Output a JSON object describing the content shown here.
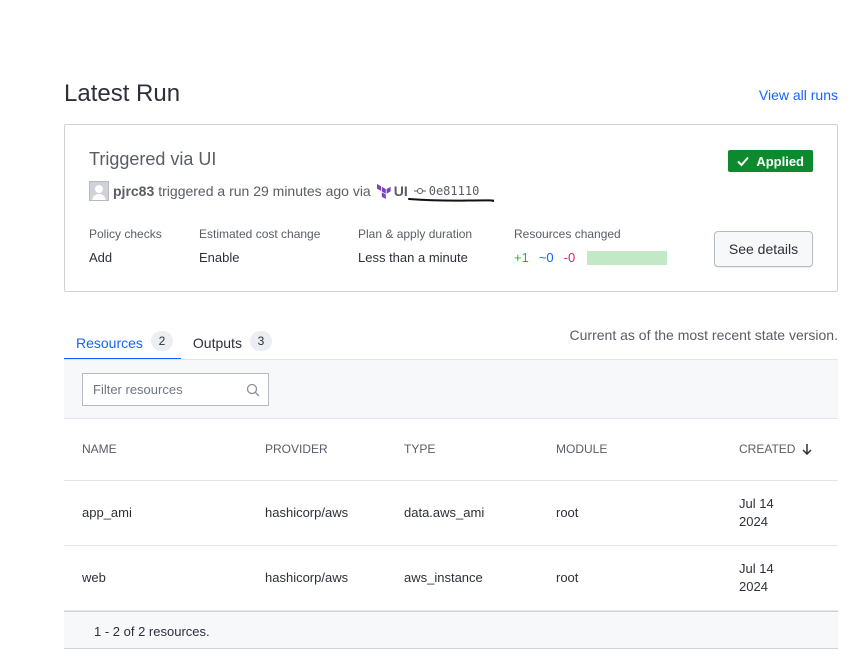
{
  "header": {
    "title": "Latest Run",
    "view_all_label": "View all runs"
  },
  "run": {
    "title": "Triggered via UI",
    "status": "Applied",
    "username": "pjrc83",
    "action_text": "triggered a run 29 minutes ago via",
    "source": "UI",
    "commit": "0e81110",
    "stats": {
      "policy_label": "Policy checks",
      "policy_value": "Add",
      "cost_label": "Estimated cost change",
      "cost_value": "Enable",
      "duration_label": "Plan & apply duration",
      "duration_value": "Less than a minute",
      "resources_label": "Resources changed",
      "added": "+1",
      "changed": "~0",
      "destroyed": "-0"
    },
    "details_button": "See details"
  },
  "tabs": [
    {
      "label": "Resources",
      "count": "2"
    },
    {
      "label": "Outputs",
      "count": "3"
    }
  ],
  "state_note": "Current as of the most recent state version.",
  "filter": {
    "placeholder": "Filter resources"
  },
  "table": {
    "headers": [
      "NAME",
      "PROVIDER",
      "TYPE",
      "MODULE",
      "CREATED"
    ],
    "rows": [
      {
        "name": "app_ami",
        "provider": "hashicorp/aws",
        "type": "data.aws_ami",
        "module": "root",
        "created_1": "Jul 14",
        "created_2": "2024"
      },
      {
        "name": "web",
        "provider": "hashicorp/aws",
        "type": "aws_instance",
        "module": "root",
        "created_1": "Jul 14",
        "created_2": "2024"
      }
    ],
    "footer": "1 - 2 of 2 resources."
  },
  "colors": {
    "accent": "#1563ff",
    "applied": "#0e8a2e",
    "terraform": "#7b42bc"
  },
  "icons": [
    "check-icon",
    "avatar",
    "terraform-icon",
    "commit-icon",
    "search-icon",
    "sort-down-arrow-icon"
  ]
}
